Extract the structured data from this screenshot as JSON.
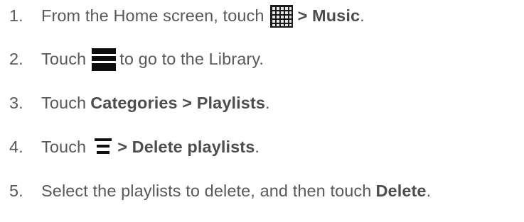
{
  "steps": [
    {
      "number": "1.",
      "pre": "From the Home screen, touch",
      "icon": "apps-grid-icon",
      "bold": "> Music",
      "post": "."
    },
    {
      "number": "2.",
      "pre": "Touch",
      "icon": "hamburger-menu-icon",
      "post": "to go to the Library."
    },
    {
      "number": "3.",
      "pre": "Touch",
      "bold": "Categories > Playlists",
      "post": "."
    },
    {
      "number": "4.",
      "pre": "Touch",
      "icon": "overflow-menu-icon",
      "bold": "> Delete playlists",
      "post": "."
    },
    {
      "number": "5.",
      "pre": "Select the playlists to delete, and then touch",
      "bold": "Delete",
      "post": "."
    }
  ]
}
